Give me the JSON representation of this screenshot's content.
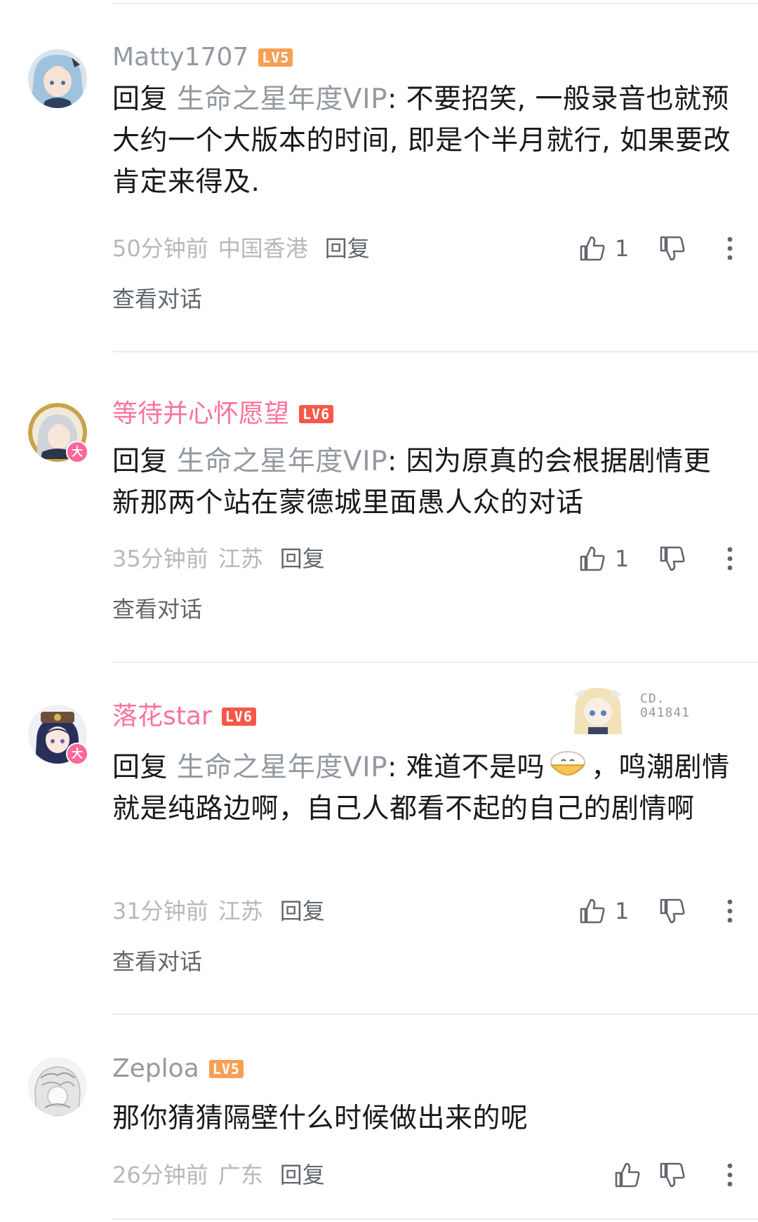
{
  "colors": {
    "name_default": "#9499a0",
    "name_vip": "#fb7299",
    "level5": "#f6a054",
    "level6": "#f7574a",
    "like_icon": "#61666d"
  },
  "comments": [
    {
      "username": "Matty1707",
      "level": "LV5",
      "reply_prefix": "回复",
      "mention": "生命之星年度VIP",
      "content": ": 不要招笑, 一般录音也就预大约一个大版本的时间, 即是个半月就行, 如果要改肯定来得及.",
      "time": "50分钟前",
      "location": "中国香港",
      "reply_label": "回复",
      "likes": "1",
      "view_conversation": "查看对话"
    },
    {
      "username": "等待并心怀愿望",
      "level": "LV6",
      "avatar_badge": "大",
      "reply_prefix": "回复",
      "mention": "生命之星年度VIP",
      "content": ": 因为原真的会根据剧情更新那两个站在蒙德城里面愚人众的对话",
      "time": "35分钟前",
      "location": "江苏",
      "reply_label": "回复",
      "likes": "1",
      "view_conversation": "查看对话"
    },
    {
      "username": "落花star",
      "level": "LV6",
      "avatar_badge": "大",
      "decoration_code_line1": "CD.",
      "decoration_code_line2": "041841",
      "reply_prefix": "回复",
      "mention": "生命之星年度VIP",
      "content_before_emoji": ": 难道不是吗",
      "content_after_emoji": "，鸣潮剧情就是纯路边啊，自己人都看不起的自己的剧情啊",
      "time": "31分钟前",
      "location": "江苏",
      "reply_label": "回复",
      "likes": "1",
      "view_conversation": "查看对话"
    },
    {
      "username": "Zeploa",
      "level": "LV5",
      "content": "那你猜猜隔壁什么时候做出来的呢",
      "time": "26分钟前",
      "location": "广东",
      "reply_label": "回复",
      "likes": ""
    }
  ]
}
